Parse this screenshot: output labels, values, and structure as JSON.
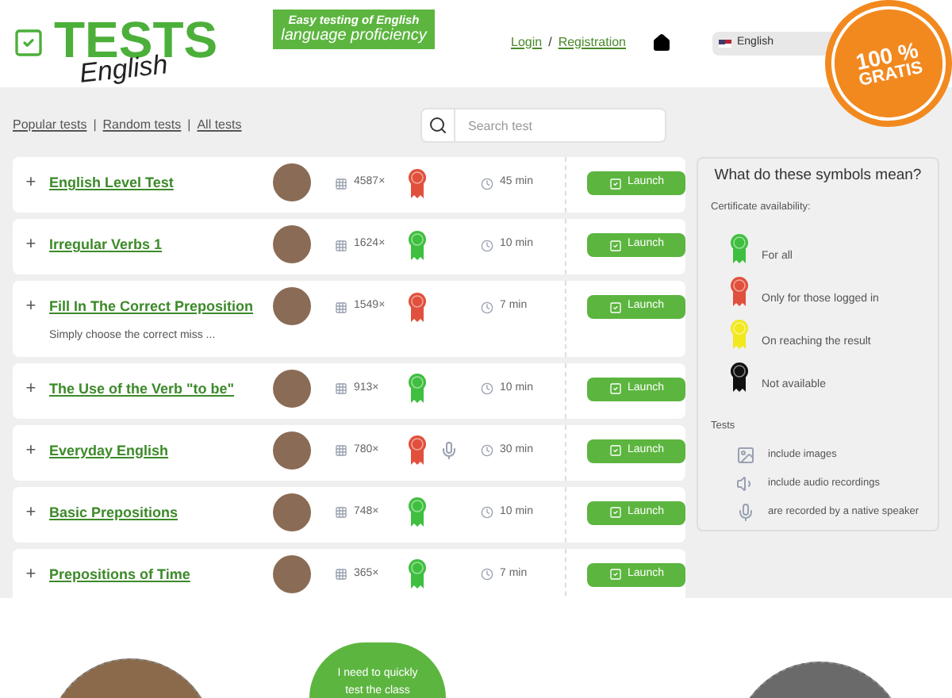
{
  "logo": {
    "title": "TESTS",
    "subtitle": "English"
  },
  "tagline": {
    "line_1": "Easy testing of English",
    "line_2": "language proficiency"
  },
  "auth": {
    "login": "Login",
    "separator": "/",
    "register": "Registration"
  },
  "language": {
    "value": "English"
  },
  "badge": {
    "line_1": "100 %",
    "line_2": "GRATIS"
  },
  "nav_links": [
    {
      "label": "Popular tests"
    },
    {
      "label": "Random tests"
    },
    {
      "label": "All tests"
    }
  ],
  "nav_separator": "|",
  "search": {
    "placeholder": "Search test"
  },
  "tests": [
    {
      "expand": "+",
      "title": "English Level Test",
      "count": "4587×",
      "color": "#e0503c",
      "native_speaker": false,
      "time": "45 min",
      "button": "Launch"
    },
    {
      "expand": "+",
      "title": "Irregular Verbs 1",
      "count": "1624×",
      "color": "#3fbf3f",
      "native_speaker": false,
      "time": "10 min",
      "button": "Launch"
    },
    {
      "expand": "+",
      "title": "Fill In The Correct Preposition",
      "description": "Simply choose the correct miss ...",
      "count": "1549×",
      "color": "#e0503c",
      "native_speaker": false,
      "time": "7 min",
      "button": "Launch"
    },
    {
      "expand": "+",
      "title": "The Use of the Verb \"to be\"",
      "count": "913×",
      "color": "#3fbf3f",
      "native_speaker": false,
      "time": "10 min",
      "button": "Launch"
    },
    {
      "expand": "+",
      "title": "Everyday English",
      "count": "780×",
      "color": "#e0503c",
      "native_speaker": true,
      "time": "30 min",
      "button": "Launch"
    },
    {
      "expand": "+",
      "title": "Basic Prepositions",
      "count": "748×",
      "color": "#3fbf3f",
      "native_speaker": false,
      "time": "10 min",
      "button": "Launch"
    },
    {
      "expand": "+",
      "title": "Prepositions of Time",
      "count": "365×",
      "color": "#3fbf3f",
      "native_speaker": false,
      "time": "7 min",
      "button": "Launch"
    }
  ],
  "legend": {
    "title": "What do these symbols mean?",
    "certificates_heading": "Certificate availability:",
    "certificates": [
      {
        "label": "For all",
        "color": "#3fbf3f"
      },
      {
        "label": "Only for those logged in",
        "color": "#e0503c"
      },
      {
        "label": "On reaching the result",
        "color": "#f2e81e"
      },
      {
        "label": "Not available",
        "color": "#111111"
      }
    ],
    "tests_heading": "Tests",
    "tests": [
      {
        "kind": "image",
        "label": "include images"
      },
      {
        "kind": "audio",
        "label": "include audio recordings"
      },
      {
        "kind": "mic",
        "label": "are recorded by a native speaker"
      }
    ]
  },
  "promo": {
    "bubble": "I need to quickly test the class"
  }
}
